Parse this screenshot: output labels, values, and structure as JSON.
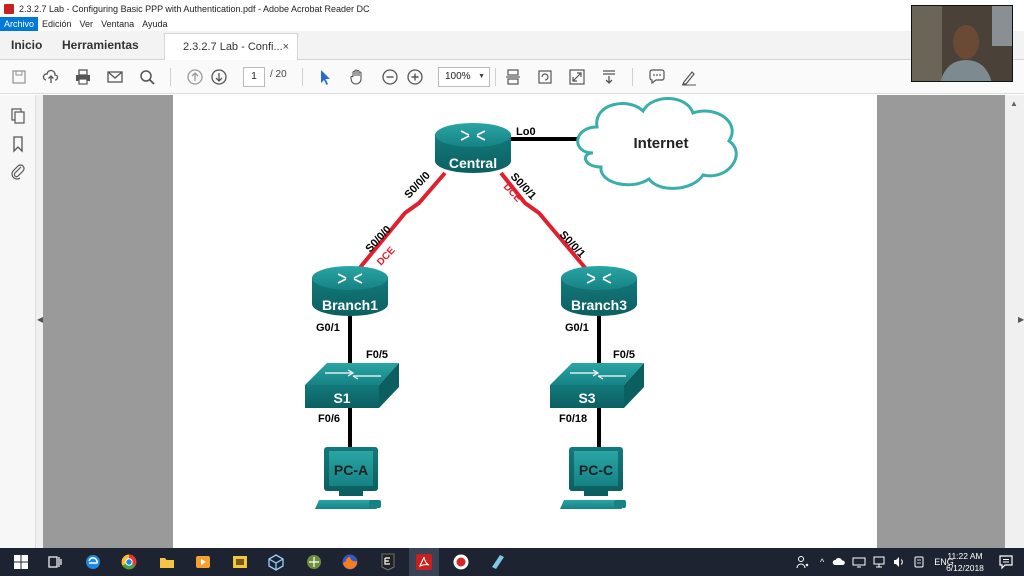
{
  "window": {
    "title": "2.3.2.7 Lab - Configuring Basic PPP with Authentication.pdf - Adobe Acrobat Reader DC"
  },
  "menu": {
    "items": [
      "Archivo",
      "Edición",
      "Ver",
      "Ventana",
      "Ayuda"
    ]
  },
  "tabs": {
    "home": "Inicio",
    "tools": "Herramientas",
    "document": "2.3.2.7 Lab - Confi...",
    "close_glyph": "×"
  },
  "toolbar": {
    "page_current": "1",
    "page_total": "/ 20",
    "zoom": "100%"
  },
  "diagram": {
    "routers": {
      "central": "Central",
      "branch1": "Branch1",
      "branch3": "Branch3"
    },
    "switches": {
      "s1": "S1",
      "s3": "S3"
    },
    "pcs": {
      "pca": "PC-A",
      "pcc": "PC-C"
    },
    "cloud": "Internet",
    "interfaces": {
      "lo0": "Lo0",
      "central_s000": "S0/0/0",
      "central_s001": "S0/0/1",
      "branch1_s000": "S0/0/0",
      "branch3_s001": "S0/0/1",
      "dce_left": "DCE",
      "dce_right": "DCE",
      "branch1_g01": "G0/1",
      "branch3_g01": "G0/1",
      "s1_f05": "F0/5",
      "s3_f05": "F0/5",
      "s1_f06": "F0/6",
      "s3_f018": "F0/18"
    },
    "colors": {
      "device_teal": "#1b8a8c",
      "device_dark": "#0f6a6c",
      "serial_red": "#e0202e",
      "cloud_stroke": "#3aafaa",
      "link": "#000000"
    }
  },
  "taskbar": {
    "lang": "ENG",
    "time": "11:22 AM",
    "date": "6/12/2018"
  }
}
